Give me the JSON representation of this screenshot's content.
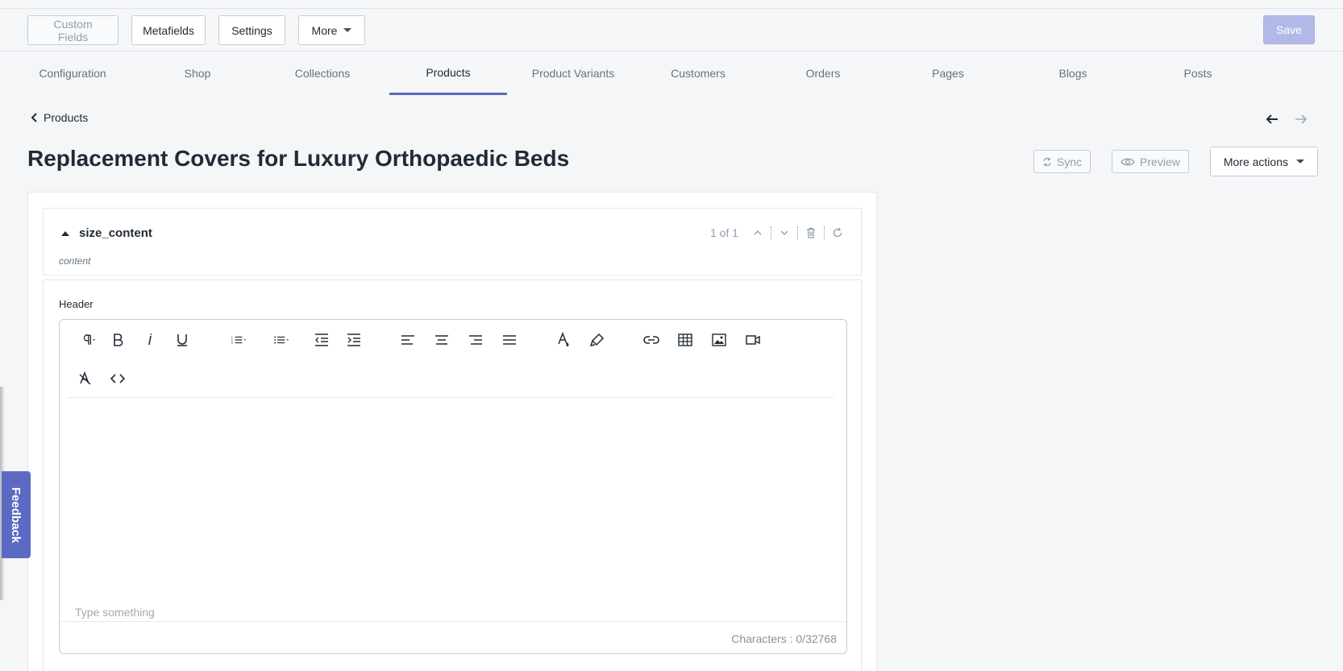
{
  "toolbar": {
    "custom_fields": "Custom Fields",
    "metafields": "Metafields",
    "settings": "Settings",
    "more": "More",
    "save": "Save"
  },
  "tabs": [
    "Configuration",
    "Shop",
    "Collections",
    "Products",
    "Product Variants",
    "Customers",
    "Orders",
    "Pages",
    "Blogs",
    "Posts"
  ],
  "active_tab": "Products",
  "breadcrumb": {
    "label": "Products"
  },
  "page": {
    "title": "Replacement Covers for Luxury Orthopaedic Beds",
    "sync": "Sync",
    "preview": "Preview",
    "more_actions": "More actions"
  },
  "section": {
    "name": "size_content",
    "subtitle": "content",
    "pager": "1 of 1"
  },
  "editor": {
    "label": "Header",
    "placeholder": "Type something",
    "counter": "Characters : 0/32768"
  },
  "feedback": "Feedback",
  "colors": {
    "accent": "#5c6ac4",
    "save_disabled": "#b3b9e6"
  }
}
